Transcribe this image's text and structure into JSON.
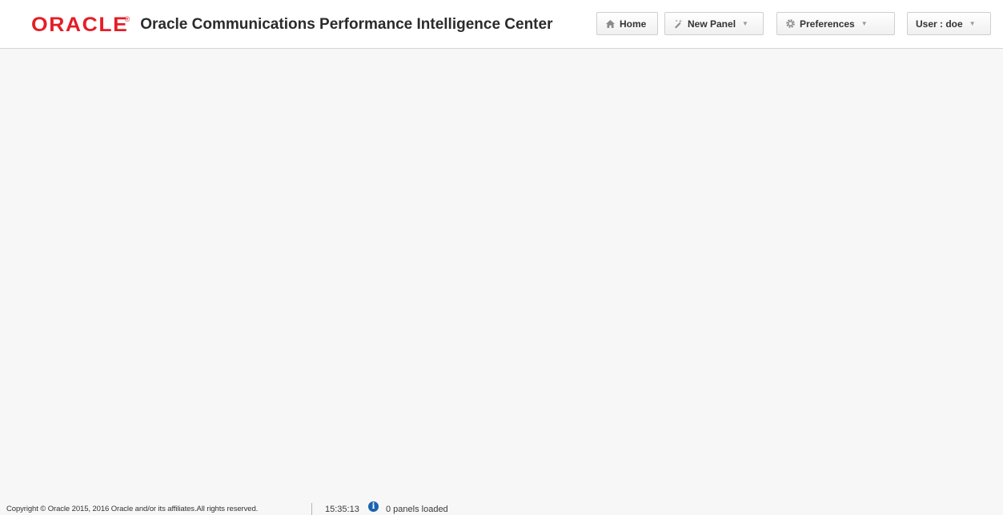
{
  "header": {
    "logo_text": "ORACLE",
    "logo_mark": "®",
    "app_title": "Oracle Communications Performance Intelligence Center",
    "nav": {
      "home": {
        "label": "Home",
        "icon": "home-icon"
      },
      "new_panel": {
        "label": "New Panel",
        "icon": "new-panel-icon",
        "has_dropdown": true
      },
      "preferences": {
        "label": "Preferences",
        "icon": "gear-icon",
        "has_dropdown": true
      },
      "user": {
        "label": "User : doe",
        "has_dropdown": true
      }
    },
    "caret": "▼"
  },
  "footer": {
    "copyright": "Copyright © Oracle 2015, 2016 Oracle and/or its affiliates.All rights reserved.",
    "time": "15:35:13",
    "info_icon_glyph": "i",
    "status": "0 panels loaded"
  },
  "colors": {
    "brand_red": "#e41e26",
    "info_blue": "#1a63b0",
    "background": "#f7f7f7"
  }
}
